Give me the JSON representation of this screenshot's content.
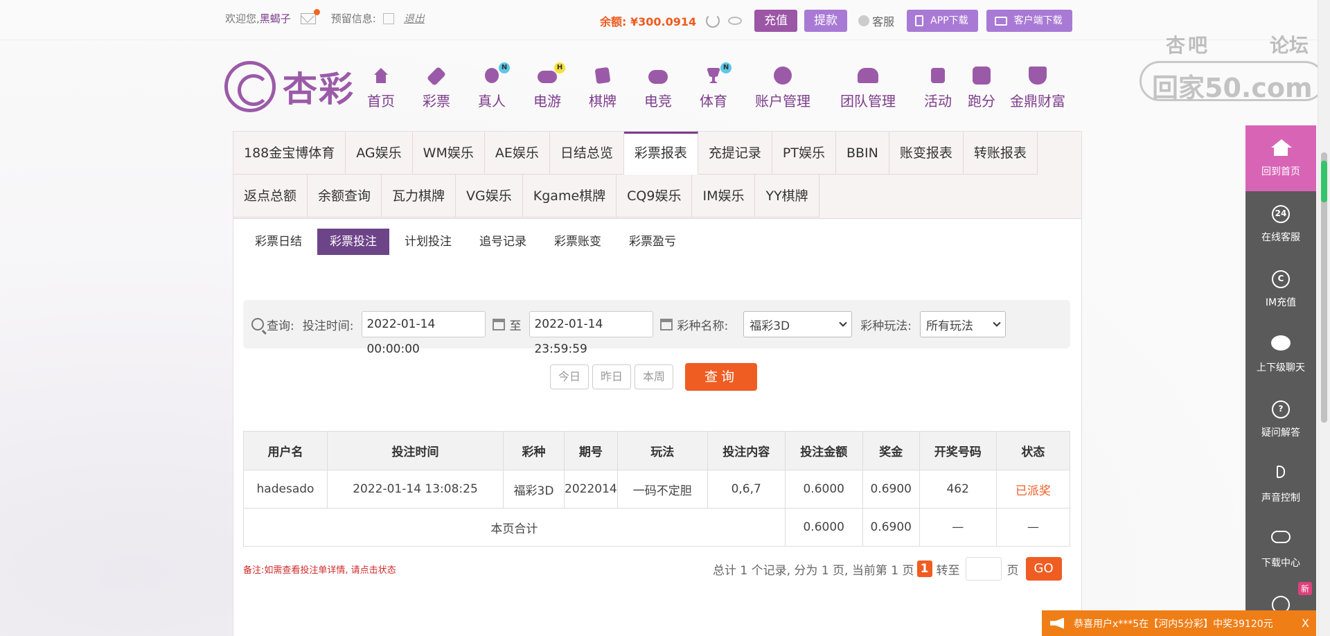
{
  "topbar": {
    "welcome": "欢迎您,",
    "username": "黑蝎子",
    "reserve_label": "预留信息:",
    "logout": "退出",
    "balance": "余额: ¥300.0914",
    "recharge": "充值",
    "withdraw": "提款",
    "service": "客服",
    "app_download": "APP下载",
    "client_download": "客户端下载"
  },
  "watermark": {
    "line1a": "杏吧",
    "line1b": "论坛",
    "line2": "回家50.com"
  },
  "logo": {
    "text": "杏彩"
  },
  "nav": [
    {
      "label": "首页",
      "badge": ""
    },
    {
      "label": "彩票",
      "badge": ""
    },
    {
      "label": "真人",
      "badge": "N"
    },
    {
      "label": "电游",
      "badge": "H"
    },
    {
      "label": "棋牌",
      "badge": ""
    },
    {
      "label": "电竞",
      "badge": ""
    },
    {
      "label": "体育",
      "badge": "N"
    },
    {
      "label": "账户管理",
      "badge": ""
    },
    {
      "label": "团队管理",
      "badge": ""
    },
    {
      "label": "活动",
      "badge": ""
    },
    {
      "label": "跑分",
      "badge": ""
    },
    {
      "label": "金鼎财富",
      "badge": ""
    }
  ],
  "tabs_row1": [
    "188金宝博体育",
    "AG娱乐",
    "WM娱乐",
    "AE娱乐",
    "日结总览",
    "彩票报表",
    "充提记录",
    "PT娱乐",
    "BBIN",
    "账变报表",
    "转账报表"
  ],
  "tabs_row2": [
    "返点总额",
    "余额查询",
    "瓦力棋牌",
    "VG娱乐",
    "Kgame棋牌",
    "CQ9娱乐",
    "IM娱乐",
    "YY棋牌"
  ],
  "subtabs": [
    "彩票日结",
    "彩票投注",
    "计划投注",
    "追号记录",
    "彩票账变",
    "彩票盈亏"
  ],
  "query": {
    "label": "查询:",
    "time_label": "投注时间:",
    "start": "2022-01-14 00:00:00",
    "to": "至",
    "end": "2022-01-14 23:59:59",
    "lottery_label": "彩种名称:",
    "lottery_value": "福彩3D",
    "play_label": "彩种玩法:",
    "play_value": "所有玩法",
    "today": "今日",
    "yesterday": "昨日",
    "week": "本周",
    "search": "查询"
  },
  "table": {
    "headers": [
      "用户名",
      "投注时间",
      "彩种",
      "期号",
      "玩法",
      "投注内容",
      "投注金额",
      "奖金",
      "开奖号码",
      "状态"
    ],
    "rows": [
      [
        "hadesado",
        "2022-01-14 13:08:25",
        "福彩3D",
        "2022014",
        "一码不定胆",
        "0,6,7",
        "0.6000",
        "0.6900",
        "462",
        "已派奖"
      ]
    ],
    "total_label": "本页合计",
    "total_amount": "0.6000",
    "total_bonus": "0.6900",
    "dash": "—"
  },
  "remark": "备注:如需查看投注单详情, 请点击状态",
  "pager": {
    "summary": "总计 1 个记录, 分为 1 页, 当前第 1 页",
    "current": "1",
    "goto": "转至",
    "page": "页",
    "go": "GO"
  },
  "side": [
    {
      "label": "回到首页"
    },
    {
      "label": "在线客服",
      "icon": "24"
    },
    {
      "label": "IM充值",
      "icon": "C"
    },
    {
      "label": "上下级聊天"
    },
    {
      "label": "疑问解答",
      "icon": "?"
    },
    {
      "label": "声音控制"
    },
    {
      "label": "下载中心"
    }
  ],
  "side_new": "新",
  "notice": {
    "text": "恭喜用户x***5在【河内5分彩】中奖39120元",
    "close": "X"
  }
}
